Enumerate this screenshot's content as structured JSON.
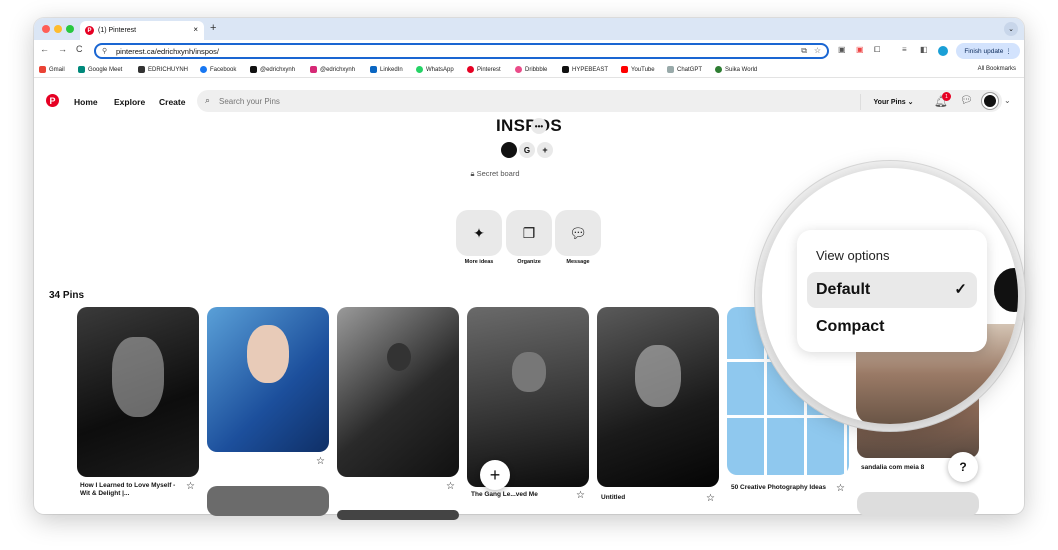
{
  "browser": {
    "tab_title": "(1) Pinterest",
    "tab_close": "×",
    "new_tab": "+",
    "url": "pinterest.ca/edrichxynh/inspos/",
    "finish_update": "Finish update ⋮",
    "nav_back": "←",
    "nav_forward": "→",
    "nav_reload": "C",
    "tab_menu": "⌄"
  },
  "bookmarks": {
    "items": [
      "Gmail",
      "Google Meet",
      "EDRICHUYNH",
      "Facebook",
      "@edrichxynh",
      "@edrichxynh",
      "LinkedIn",
      "WhatsApp",
      "Pinterest",
      "Dribbble",
      "HYPEBEAST",
      "YouTube",
      "ChatGPT",
      "Suika World"
    ],
    "all": "All Bookmarks"
  },
  "pinterest": {
    "nav": {
      "home": "Home",
      "explore": "Explore",
      "create": "Create"
    },
    "search_placeholder": "Search your Pins",
    "your_pins": "Your Pins ⌄",
    "notif_count": "1"
  },
  "board": {
    "title": "INSPOS",
    "collab_g": "G",
    "secret": "Secret board",
    "actions": [
      "More ideas",
      "Organize",
      "Message"
    ],
    "pin_count": "34 Pins"
  },
  "pins": {
    "captions": [
      "How I Learned to Love Myself - Wit & Delight |...",
      "The Gang Le...ved Me",
      "Untitled",
      "50 Creative Photography Ideas",
      "sandalia com meia 8"
    ]
  },
  "view_options": {
    "title": "View options",
    "default": "Default",
    "compact": "Compact",
    "check": "✓"
  },
  "help": "?",
  "fab": "+",
  "colors": {
    "brand": "#e60023",
    "accent": "#1a66d2"
  }
}
